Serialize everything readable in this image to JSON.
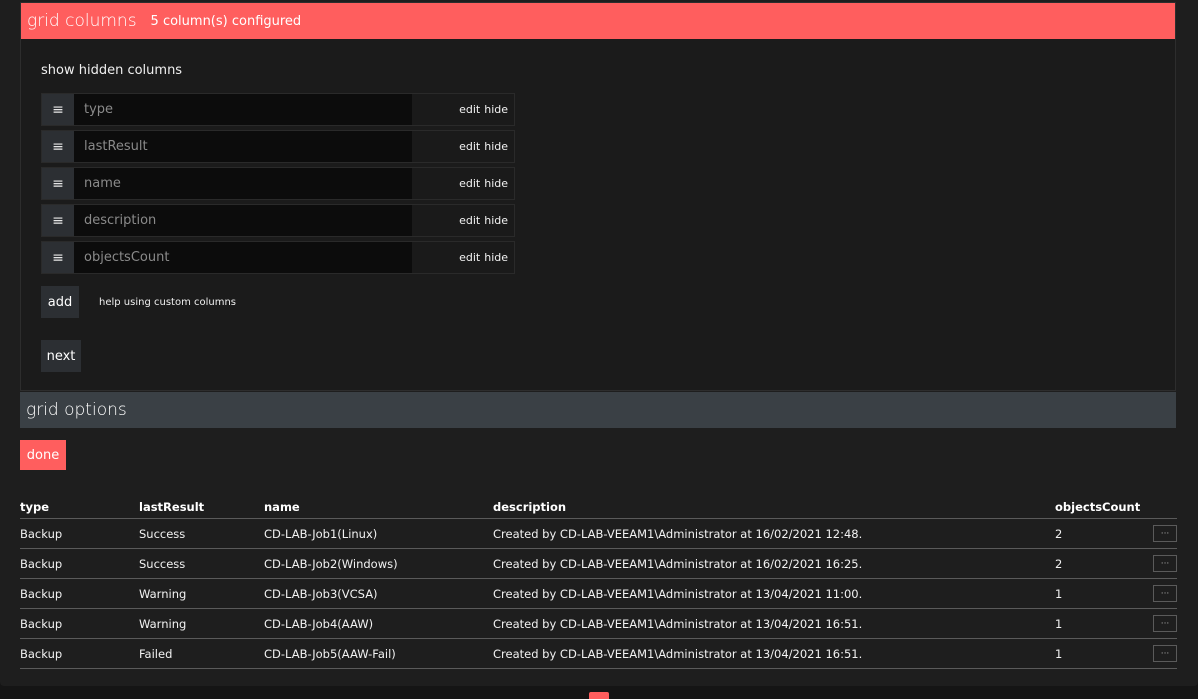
{
  "grid_columns": {
    "title": "grid columns",
    "subtitle": "5 column(s) configured",
    "show_hidden_label": "show hidden columns",
    "drag_icon": "≡",
    "columns": [
      {
        "value": "type",
        "edit": "edit",
        "hide": "hide"
      },
      {
        "value": "lastResult",
        "edit": "edit",
        "hide": "hide"
      },
      {
        "value": "name",
        "edit": "edit",
        "hide": "hide"
      },
      {
        "value": "description",
        "edit": "edit",
        "hide": "hide"
      },
      {
        "value": "objectsCount",
        "edit": "edit",
        "hide": "hide"
      }
    ],
    "add_label": "add",
    "help_label": "help using custom columns",
    "next_label": "next"
  },
  "grid_options": {
    "title": "grid options"
  },
  "done_label": "done",
  "table": {
    "headers": {
      "type": "type",
      "lastResult": "lastResult",
      "name": "name",
      "description": "description",
      "objectsCount": "objectsCount"
    },
    "more_label": "···",
    "rows": [
      {
        "type": "Backup",
        "lastResult": "Success",
        "name": "CD-LAB-Job1(Linux)",
        "description": "Created by CD-LAB-VEEAM1\\Administrator at 16/02/2021 12:48.",
        "objectsCount": "2"
      },
      {
        "type": "Backup",
        "lastResult": "Success",
        "name": "CD-LAB-Job2(Windows)",
        "description": "Created by CD-LAB-VEEAM1\\Administrator at 16/02/2021 16:25.",
        "objectsCount": "2"
      },
      {
        "type": "Backup",
        "lastResult": "Warning",
        "name": "CD-LAB-Job3(VCSA)",
        "description": "Created by CD-LAB-VEEAM1\\Administrator at 13/04/2021 11:00.",
        "objectsCount": "1"
      },
      {
        "type": "Backup",
        "lastResult": "Warning",
        "name": "CD-LAB-Job4(AAW)",
        "description": "Created by CD-LAB-VEEAM1\\Administrator at 13/04/2021 16:51.",
        "objectsCount": "1"
      },
      {
        "type": "Backup",
        "lastResult": "Failed",
        "name": "CD-LAB-Job5(AAW-Fail)",
        "description": "Created by CD-LAB-VEEAM1\\Administrator at 13/04/2021 16:51.",
        "objectsCount": "1"
      }
    ]
  },
  "colors": {
    "accent": "#ff5e5e",
    "options_bar": "#3a4045",
    "background": "#1e1e1e"
  }
}
